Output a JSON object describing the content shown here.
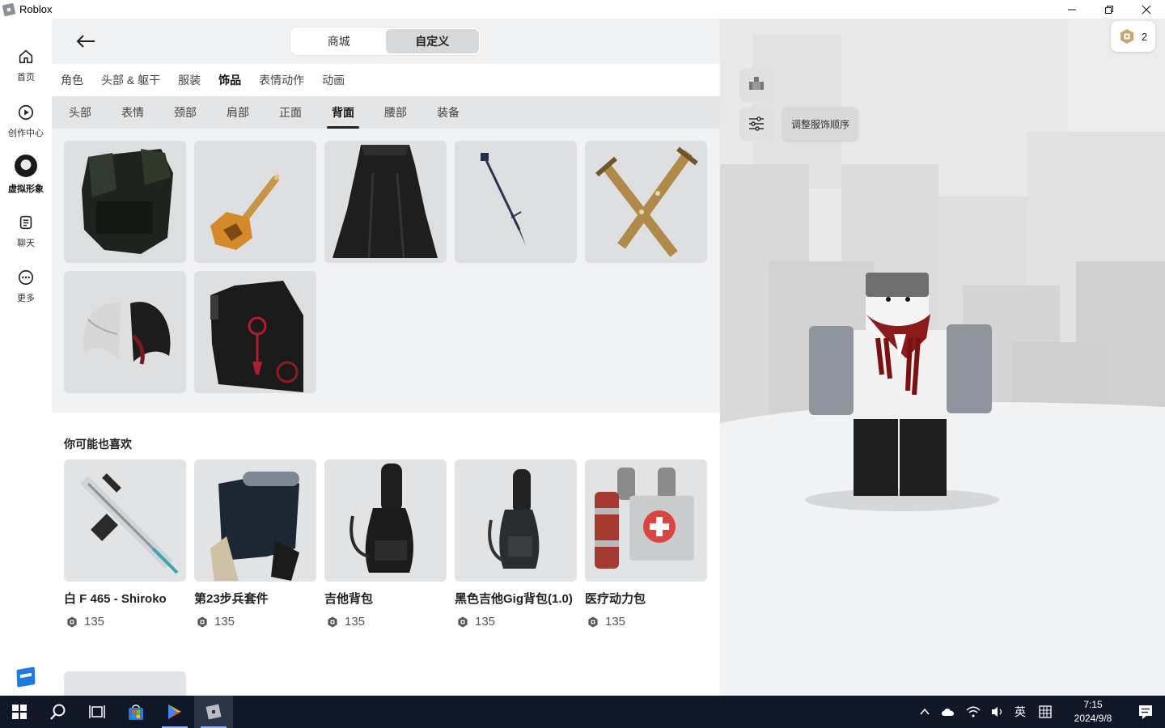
{
  "window": {
    "title": "Roblox"
  },
  "nav": {
    "items": [
      {
        "label": "首页",
        "icon": "home-icon"
      },
      {
        "label": "创作中心",
        "icon": "play-circle-icon"
      },
      {
        "label": "虚拟形象",
        "icon": "avatar"
      },
      {
        "label": "聊天",
        "icon": "chat-icon"
      },
      {
        "label": "更多",
        "icon": "more-icon"
      }
    ]
  },
  "segment": {
    "shop": "商城",
    "customize": "自定义",
    "selected": "自定义"
  },
  "categories": [
    "角色",
    "头部 & 躯干",
    "服装",
    "饰品",
    "表情动作",
    "动画"
  ],
  "active_category": "饰品",
  "subcategories": [
    "头部",
    "表情",
    "颈部",
    "肩部",
    "正面",
    "背面",
    "腰部",
    "装备"
  ],
  "active_subcategory": "背面",
  "owned_items": [
    {
      "icon": "backpack-armor-icon"
    },
    {
      "icon": "golden-staff-icon"
    },
    {
      "icon": "black-cape-icon"
    },
    {
      "icon": "spear-icon"
    },
    {
      "icon": "crossed-swords-icon"
    },
    {
      "icon": "wings-icon"
    },
    {
      "icon": "black-robe-icon"
    }
  ],
  "recommendations": {
    "title": "你可能也喜欢",
    "items": [
      {
        "name": "白 F 465 - Shiroko",
        "price": "135",
        "icon": "rifle-icon"
      },
      {
        "name": "第23步兵套件",
        "price": "135",
        "icon": "infantry-kit-icon"
      },
      {
        "name": "吉他背包",
        "price": "135",
        "icon": "guitar-case-icon"
      },
      {
        "name": "黑色吉他Gig背包(1.0)",
        "price": "135",
        "icon": "gig-bag-icon"
      },
      {
        "name": "医疗动力包",
        "price": "135",
        "icon": "medic-pack-icon"
      }
    ]
  },
  "viewport": {
    "robux_balance": "2",
    "tooltip": "调整服饰顺序"
  },
  "taskbar": {
    "ime": "英",
    "time": "7:15",
    "date": "2024/9/8"
  },
  "colors": {
    "accent": "#1f7ae0",
    "taskbar": "#101828",
    "panel": "#f1f2f4"
  }
}
